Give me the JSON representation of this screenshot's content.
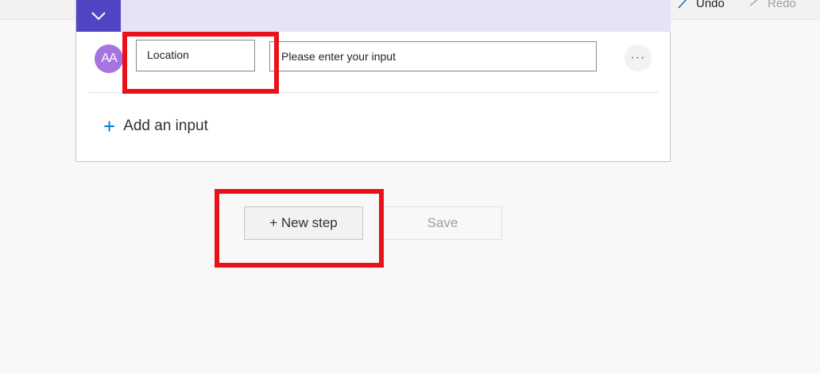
{
  "toolbar": {
    "undo_label": "Undo",
    "redo_label": "Redo"
  },
  "trigger_card": {
    "avatar_text": "AA",
    "input_name": "Location",
    "input_value_placeholder": "Please enter your input",
    "more_options": "···",
    "add_input_label": "Add an input"
  },
  "actions": {
    "new_step_label": "+ New step",
    "save_label": "Save"
  },
  "colors": {
    "accent": "#5145c4",
    "header_bg": "#e5e3f5",
    "avatar_bg": "#a574de",
    "link_blue": "#0078d4",
    "highlight": "#e8121a"
  }
}
